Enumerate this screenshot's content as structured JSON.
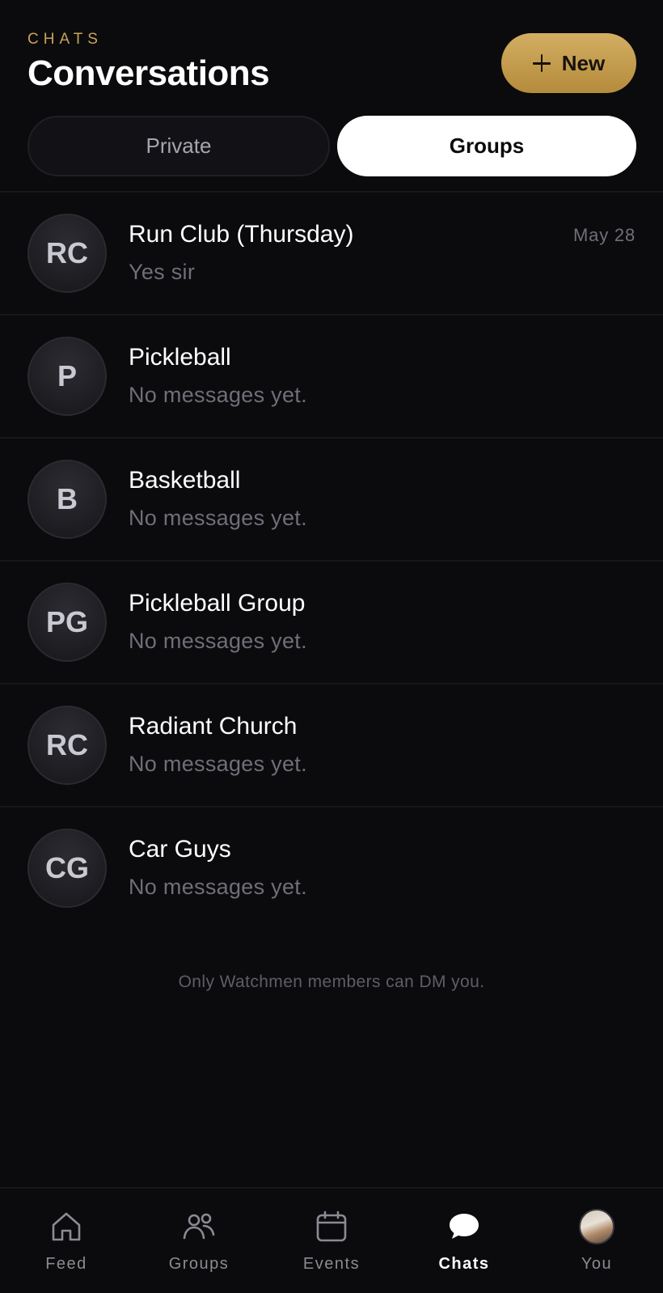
{
  "header": {
    "eyebrow": "CHATS",
    "title": "Conversations",
    "new_button_label": "New"
  },
  "segments": {
    "private_label": "Private",
    "groups_label": "Groups",
    "selected": "Groups"
  },
  "conversations": [
    {
      "initials": "RC",
      "name": "Run Club (Thursday)",
      "preview": "Yes sir",
      "date": "May 28"
    },
    {
      "initials": "P",
      "name": "Pickleball",
      "preview": "No messages yet."
    },
    {
      "initials": "B",
      "name": "Basketball",
      "preview": "No messages yet."
    },
    {
      "initials": "PG",
      "name": "Pickleball Group",
      "preview": "No messages yet."
    },
    {
      "initials": "RC",
      "name": "Radiant Church",
      "preview": "No messages yet."
    },
    {
      "initials": "CG",
      "name": "Car Guys",
      "preview": "No messages yet."
    }
  ],
  "footnote": "Only Watchmen members can DM you.",
  "tabbar": {
    "items": [
      {
        "label": "Feed",
        "icon": "home-icon"
      },
      {
        "label": "Groups",
        "icon": "people-icon"
      },
      {
        "label": "Events",
        "icon": "calendar-icon"
      },
      {
        "label": "Chats",
        "icon": "chat-bubble-icon",
        "active": true
      },
      {
        "label": "You",
        "icon": "profile-photo"
      }
    ]
  },
  "colors": {
    "background": "#0b0b0d",
    "accent_gold": "#c8a35a",
    "muted_text": "#6e6f78"
  }
}
